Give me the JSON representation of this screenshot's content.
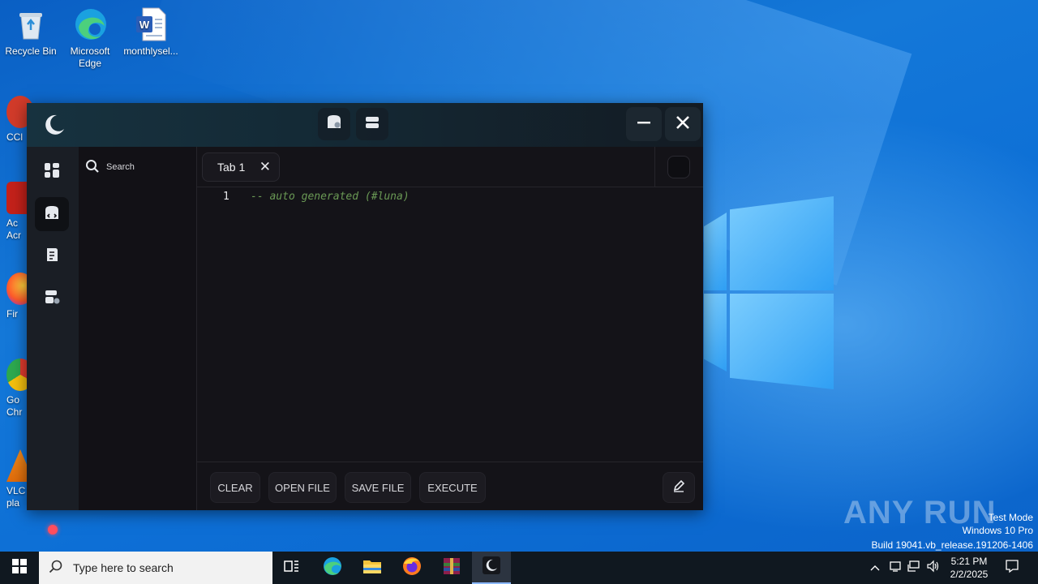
{
  "desktop": {
    "icons": [
      {
        "label": "Recycle Bin"
      },
      {
        "label": "Microsoft Edge"
      },
      {
        "label": "monthlysel..."
      }
    ],
    "partial_labels": [
      "CCl",
      "Ac\nAcr",
      "Fir",
      "Go\nChr",
      "VLC\npla"
    ]
  },
  "app": {
    "toolbar_icons": [
      "script-hub-icon",
      "storage-icon"
    ],
    "window_controls": {
      "minimize": "—",
      "close": "✕"
    },
    "rail": [
      "dashboard-icon",
      "editor-icon",
      "scripts-icon",
      "settings-icon"
    ],
    "search": {
      "placeholder": "Search"
    },
    "tabs": [
      {
        "label": "Tab 1",
        "close": "✕"
      }
    ],
    "editor": {
      "lines": [
        {
          "number": "1",
          "text": "-- auto generated (#luna)"
        }
      ]
    },
    "actions": {
      "clear": "CLEAR",
      "open_file": "OPEN FILE",
      "save_file": "SAVE FILE",
      "execute": "EXECUTE"
    },
    "status_color": "#ff4d5e"
  },
  "watermark": {
    "brand": "ANY RUN",
    "mode": "Test Mode",
    "os": "Windows 10 Pro",
    "build": "Build 19041.vb_release.191206-1406"
  },
  "taskbar": {
    "search_placeholder": "Type here to search",
    "apps": [
      "task-view-icon",
      "edge-icon",
      "file-explorer-icon",
      "firefox-icon",
      "winrar-icon",
      "luna-icon"
    ],
    "clock": {
      "time": "5:21 PM",
      "date": "2/2/2025"
    }
  }
}
